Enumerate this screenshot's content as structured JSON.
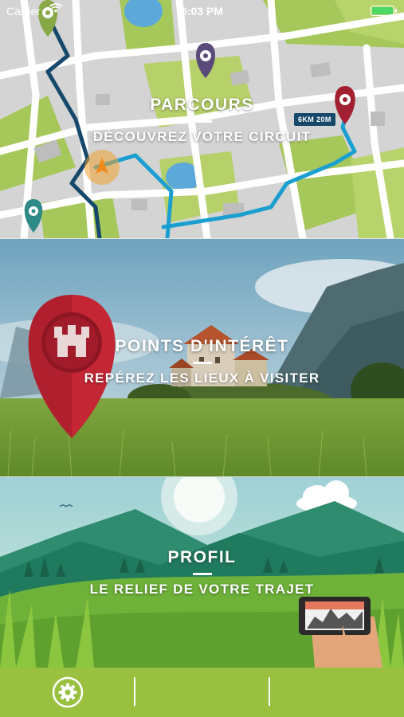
{
  "status_bar": {
    "carrier": "Carrier",
    "time": "6:03 PM",
    "battery_color": "#4cd964"
  },
  "panels": {
    "parcours": {
      "title": "PARCOURS",
      "subtitle": "DÉCOUVREZ VOTRE CIRCUIT",
      "distance_badge": "6KM 20M"
    },
    "poi": {
      "title": "POINTS D'INTÉRÊT",
      "subtitle": "REPÉREZ LES LIEUX À VISITER"
    },
    "profil": {
      "title": "PROFIL",
      "subtitle": "LE RELIEF DE VOTRE TRAJET"
    }
  },
  "tab_bar": {
    "color": "#99c13f",
    "items": [
      {
        "icon": "gear-icon"
      },
      {
        "icon": ""
      },
      {
        "icon": ""
      }
    ]
  },
  "colors": {
    "route": "#1a9fd0",
    "route_dark": "#16486b",
    "map_green": "#a6c75a",
    "map_bg": "#d4d4d4",
    "pin_red": "#b01f2e"
  }
}
